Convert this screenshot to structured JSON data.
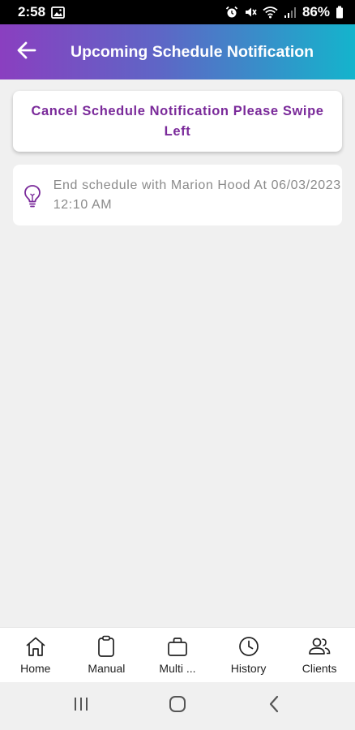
{
  "status_bar": {
    "time": "2:58",
    "battery": "86%"
  },
  "header": {
    "title": "Upcoming Schedule Notification",
    "back_icon": "arrow-left-icon"
  },
  "info_card": {
    "text": "Cancel Schedule Notification Please Swipe Left"
  },
  "notification": {
    "icon": "lightbulb-icon",
    "text": "End schedule with Marion Hood At 06/03/2023 12:10 AM"
  },
  "bottom_nav": {
    "items": [
      {
        "label": "Home",
        "icon": "home-icon"
      },
      {
        "label": "Manual",
        "icon": "clipboard-icon"
      },
      {
        "label": "Multi ...",
        "icon": "briefcase-icon"
      },
      {
        "label": "History",
        "icon": "clock-icon"
      },
      {
        "label": "Clients",
        "icon": "users-icon"
      }
    ]
  },
  "colors": {
    "header_gradient_start": "#8a3fc0",
    "header_gradient_end": "#14b4cc",
    "accent_purple": "#7a2a9a",
    "background": "#f0f0f0"
  }
}
